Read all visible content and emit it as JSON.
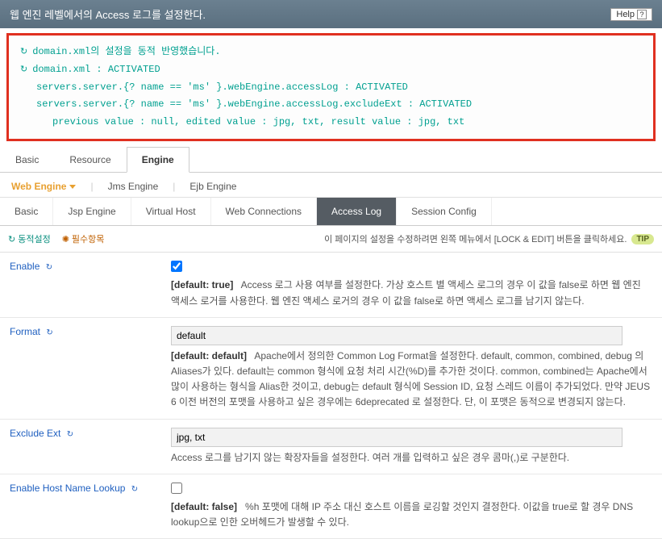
{
  "header": {
    "title": "웹 엔진 레벨에서의 Access 로그를 설정한다.",
    "help": "Help"
  },
  "messages": {
    "line1": "domain.xml의 설정을 동적 반영했습니다.",
    "line2": "domain.xml : ACTIVATED",
    "line3": "servers.server.{? name == 'ms' }.webEngine.accessLog : ACTIVATED",
    "line4": "servers.server.{? name == 'ms' }.webEngine.accessLog.excludeExt : ACTIVATED",
    "line5": "previous value : null, edited value : jpg, txt, result value : jpg, txt"
  },
  "main_tabs": {
    "basic": "Basic",
    "resource": "Resource",
    "engine": "Engine"
  },
  "engine_tabs": {
    "web": "Web Engine",
    "jms": "Jms Engine",
    "ejb": "Ejb Engine"
  },
  "sub_tabs": {
    "basic": "Basic",
    "jsp": "Jsp Engine",
    "vhost": "Virtual Host",
    "webconn": "Web Connections",
    "access": "Access Log",
    "session": "Session Config"
  },
  "info": {
    "dynamic": "동적설정",
    "required": "필수항목",
    "tip_text": "이 페이지의 설정을 수정하려면 왼쪽 메뉴에서 [LOCK & EDIT] 버튼을 클릭하세요.",
    "tip_badge": "TIP"
  },
  "fields": {
    "enable": {
      "label": "Enable",
      "checked": true,
      "default": "[default: true]",
      "desc": "Access 로그 사용 여부를 설정한다. 가상 호스트 별 액세스 로그의 경우 이 값을 false로 하면 웹 엔진 액세스 로거를 사용한다. 웹 엔진 액세스 로거의 경우 이 값을 false로 하면 액세스 로그를 남기지 않는다."
    },
    "format": {
      "label": "Format",
      "value": "default",
      "default": "[default: default]",
      "desc": "Apache에서 정의한 Common Log Format을 설정한다. default, common, combined, debug 의 Aliases가 있다. default는 common 형식에 요청 처리 시간(%D)를 추가한 것이다. common, combined는 Apache에서 많이 사용하는 형식을 Alias한 것이고, debug는 default 형식에 Session ID, 요청 스레드 이름이 추가되었다. 만약 JEUS 6 이전 버전의 포맷을 사용하고 싶은 경우에는 6deprecated 로 설정한다. 단, 이 포맷은 동적으로 변경되지 않는다."
    },
    "excludeExt": {
      "label": "Exclude Ext",
      "value": "jpg, txt",
      "desc": "Access 로그를 남기지 않는 확장자들을 설정한다. 여러 개를 입력하고 싶은 경우 콤마(,)로 구분한다."
    },
    "hostLookup": {
      "label": "Enable Host Name Lookup",
      "checked": false,
      "default": "[default: false]",
      "desc": "%h 포맷에 대해 IP 주소 대신 호스트 이름을 로깅할 것인지 결정한다. 이값을 true로 할 경우 DNS lookup으로 인한 오버헤드가 발생할 수 있다."
    }
  }
}
